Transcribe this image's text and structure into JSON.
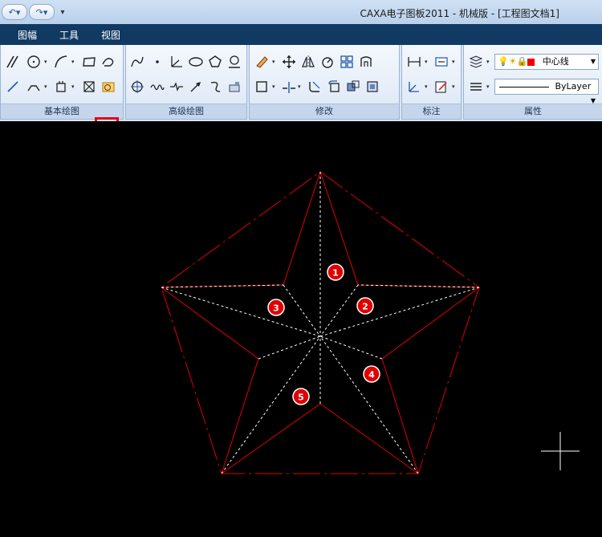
{
  "window": {
    "title": "CAXA电子图板2011 - 机械版 - [工程图文档1]"
  },
  "menu": {
    "items": [
      "图幅",
      "工具",
      "视图"
    ]
  },
  "ribbon": {
    "groups": {
      "basic": "基本绘图",
      "advanced": "高级绘图",
      "modify": "修改",
      "dimension": "标注",
      "properties": "属性"
    }
  },
  "properties": {
    "linetype": "中心线",
    "layer_line": "ByLayer"
  },
  "canvas": {
    "labels": [
      "1",
      "2",
      "3",
      "4",
      "5"
    ],
    "colors": {
      "background": "#000000",
      "pentagon": "#e00000",
      "star": "#ffffff",
      "marker": "#e00000"
    }
  }
}
